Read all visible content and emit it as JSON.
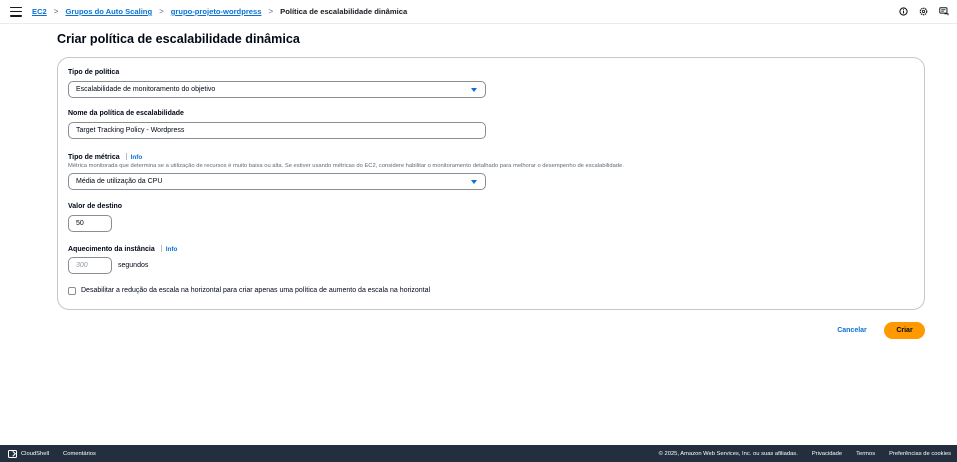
{
  "breadcrumbs": {
    "items": [
      "EC2",
      "Grupos do Auto Scaling",
      "grupo-projeto-wordpress"
    ],
    "current": "Política de escalabilidade dinâmica",
    "separator": ">"
  },
  "header_icons": [
    "info-circle-icon",
    "settings-gear-icon",
    "notifications-icon"
  ],
  "page": {
    "title": "Criar política de escalabilidade dinâmica"
  },
  "form": {
    "policy_type": {
      "label": "Tipo de política",
      "value": "Escalabilidade de monitoramento do objetivo"
    },
    "policy_name": {
      "label": "Nome da política de escalabilidade",
      "value": "Target Tracking Policy - Wordpress"
    },
    "metric_type": {
      "label": "Tipo de métrica",
      "info": "Info",
      "description": "Métrica monitorada que determina se a utilização de recursos é muito baixa ou alta. Se estiver usando métricas do EC2, considere habilitar o monitoramento detalhado para melhorar o desempenho de escalabilidade.",
      "value": "Média de utilização da CPU"
    },
    "target_value": {
      "label": "Valor de destino",
      "value": "50"
    },
    "instance_warmup": {
      "label": "Aquecimento da instância",
      "info": "Info",
      "placeholder": "300",
      "unit": "segundos"
    },
    "disable_scale_in": {
      "label": "Desabilitar a redução da escala na horizontal para criar apenas uma política de aumento da escala na horizontal",
      "checked": false
    }
  },
  "actions": {
    "cancel": "Cancelar",
    "create": "Criar"
  },
  "footer": {
    "cloudshell": "CloudShell",
    "feedback": "Comentários",
    "copyright": "© 2025, Amazon Web Services, Inc. ou suas afiliadas.",
    "privacy": "Privacidade",
    "terms": "Termos",
    "cookies": "Preferências de cookies"
  },
  "colors": {
    "accent": "#0972d3",
    "primary_button": "#ff9900",
    "footer_bg": "#232f3e"
  }
}
